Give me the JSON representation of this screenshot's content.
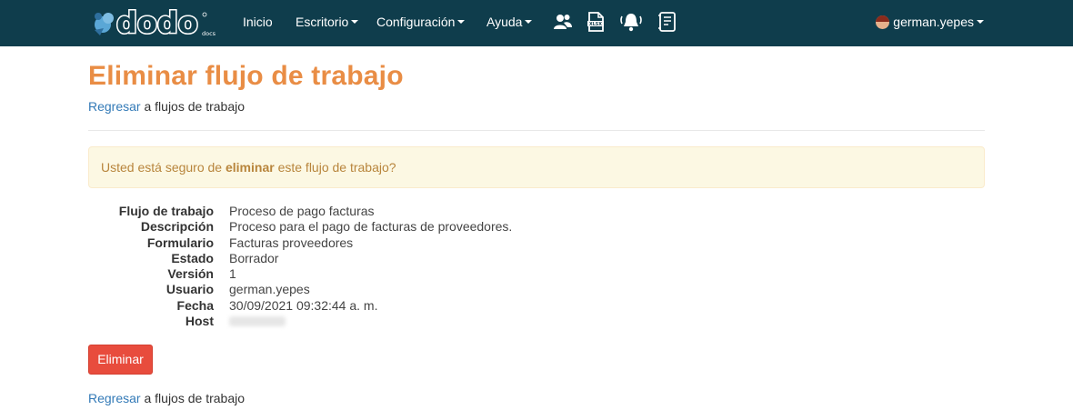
{
  "brand": {
    "name": "dodo",
    "sub": "DOCS",
    "accent": "#e98d45",
    "navbar_bg": "#0f3d4c"
  },
  "nav": {
    "inicio": "Inicio",
    "escritorio": "Escritorio",
    "configuracion": "Configuración",
    "ayuda": "Ayuda",
    "icons": [
      "users-icon",
      "xlsx-file-icon",
      "bell-icon",
      "document-list-icon"
    ],
    "user": "german.yepes"
  },
  "page": {
    "title": "Eliminar flujo de trabajo",
    "back_link": "Regresar",
    "back_rest": " a flujos de trabajo"
  },
  "alert": {
    "before": "Usted está seguro de ",
    "strong": "eliminar",
    "after": " este flujo de trabajo?"
  },
  "details": [
    {
      "label": "Flujo de trabajo",
      "value": "Proceso de pago facturas"
    },
    {
      "label": "Descripción",
      "value": "Proceso para el pago de facturas de proveedores."
    },
    {
      "label": "Formulario",
      "value": "Facturas proveedores"
    },
    {
      "label": "Estado",
      "value": "Borrador"
    },
    {
      "label": "Versión",
      "value": "1"
    },
    {
      "label": "Usuario",
      "value": "german.yepes"
    },
    {
      "label": "Fecha",
      "value": "30/09/2021 09:32:44 a. m."
    },
    {
      "label": "Host",
      "value": ""
    }
  ],
  "actions": {
    "delete_label": "Eliminar",
    "delete_color": "#e84c3d"
  }
}
